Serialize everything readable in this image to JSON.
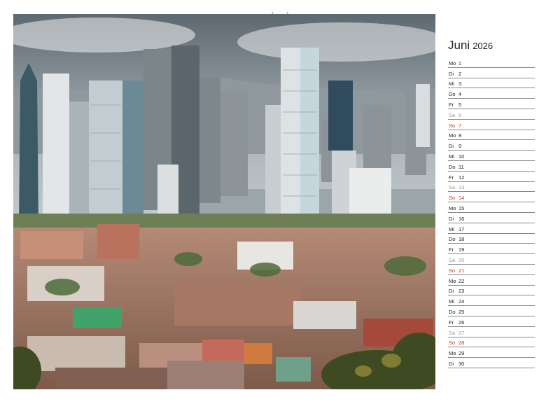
{
  "calendar": {
    "month": "Juni",
    "year": "2026",
    "days": [
      {
        "dn": "Mo",
        "num": "1",
        "kind": "wd"
      },
      {
        "dn": "Di",
        "num": "2",
        "kind": "wd"
      },
      {
        "dn": "Mi",
        "num": "3",
        "kind": "wd"
      },
      {
        "dn": "Do",
        "num": "4",
        "kind": "wd"
      },
      {
        "dn": "Fr",
        "num": "5",
        "kind": "wd"
      },
      {
        "dn": "Sa",
        "num": "6",
        "kind": "sat"
      },
      {
        "dn": "So",
        "num": "7",
        "kind": "sun"
      },
      {
        "dn": "Mo",
        "num": "8",
        "kind": "wd"
      },
      {
        "dn": "Di",
        "num": "9",
        "kind": "wd"
      },
      {
        "dn": "Mi",
        "num": "10",
        "kind": "wd"
      },
      {
        "dn": "Do",
        "num": "11",
        "kind": "wd"
      },
      {
        "dn": "Fr",
        "num": "12",
        "kind": "wd"
      },
      {
        "dn": "Sa",
        "num": "13",
        "kind": "sat"
      },
      {
        "dn": "So",
        "num": "14",
        "kind": "sun"
      },
      {
        "dn": "Mo",
        "num": "15",
        "kind": "wd"
      },
      {
        "dn": "Di",
        "num": "16",
        "kind": "wd"
      },
      {
        "dn": "Mi",
        "num": "17",
        "kind": "wd"
      },
      {
        "dn": "Do",
        "num": "18",
        "kind": "wd"
      },
      {
        "dn": "Fr",
        "num": "19",
        "kind": "wd"
      },
      {
        "dn": "Sa",
        "num": "20",
        "kind": "sat"
      },
      {
        "dn": "So",
        "num": "21",
        "kind": "sun"
      },
      {
        "dn": "Mo",
        "num": "22",
        "kind": "wd"
      },
      {
        "dn": "Di",
        "num": "23",
        "kind": "wd"
      },
      {
        "dn": "Mi",
        "num": "24",
        "kind": "wd"
      },
      {
        "dn": "Do",
        "num": "25",
        "kind": "wd"
      },
      {
        "dn": "Fr",
        "num": "26",
        "kind": "wd"
      },
      {
        "dn": "Sa",
        "num": "27",
        "kind": "sat"
      },
      {
        "dn": "So",
        "num": "28",
        "kind": "sun"
      },
      {
        "dn": "Mo",
        "num": "29",
        "kind": "wd"
      },
      {
        "dn": "Di",
        "num": "30",
        "kind": "wd"
      }
    ]
  },
  "colors": {
    "sunday": "#c0392b",
    "saturday": "#9a9a9a",
    "weekday": "#222222",
    "rule": "#8a8a8a"
  },
  "photo": {
    "subject": "city-skyline-photo"
  }
}
